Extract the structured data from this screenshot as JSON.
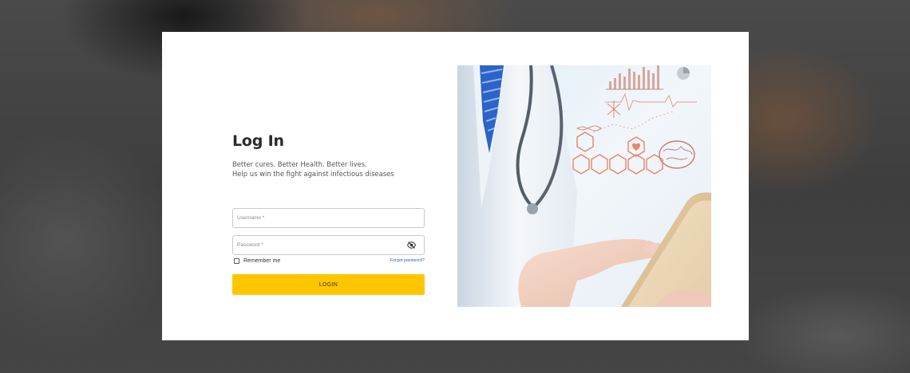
{
  "login": {
    "title": "Log In",
    "tagline_line1": "Better cures. Better Health. Better lives.",
    "tagline_line2": "Help us win the fight against infectious diseases",
    "username": {
      "placeholder": "Username *",
      "value": ""
    },
    "password": {
      "placeholder": "Password *",
      "value": ""
    },
    "remember_label": "Remember me",
    "remember_checked": false,
    "forgot_label": "Forgot password?",
    "login_button": "LOGIN"
  },
  "colors": {
    "accent": "#ffc600",
    "link": "#3b5bbd",
    "hero_icons": "#e8866a"
  },
  "icons": {
    "password_toggle": "eye-slash-icon"
  }
}
